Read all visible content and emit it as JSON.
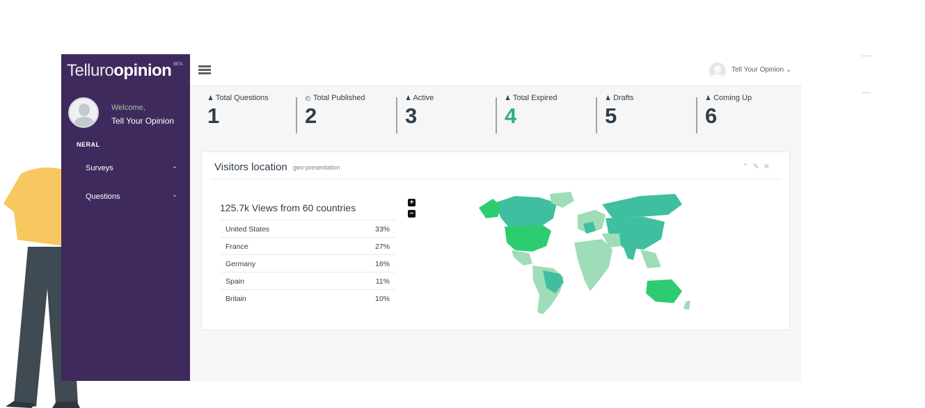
{
  "app": {
    "brand_light": "Telluro",
    "brand_bold": "opinion",
    "brand_beta": "BETA"
  },
  "sidebar": {
    "welcome": "Welcome,",
    "username": "Tell Your Opinion",
    "section_label": "NERAL",
    "items": [
      {
        "label": "Surveys",
        "icon": "clipboard-icon"
      },
      {
        "label": "Questions",
        "icon": "question-icon"
      }
    ]
  },
  "header": {
    "user_menu": "Tell Your Opinion"
  },
  "stats": [
    {
      "caption": "Total Questions",
      "value": "1",
      "icon": "user-icon"
    },
    {
      "caption": "Total Published",
      "value": "2",
      "icon": "clock-icon"
    },
    {
      "caption": "Active",
      "value": "3",
      "icon": "user-icon"
    },
    {
      "caption": "Total Expired",
      "value": "4",
      "icon": "user-icon",
      "color": "#2fb089"
    },
    {
      "caption": "Drafts",
      "value": "5",
      "icon": "user-icon"
    },
    {
      "caption": "Coming Up",
      "value": "6",
      "icon": "user-icon"
    }
  ],
  "panel": {
    "title": "Visitors location",
    "subtitle": "geo-presentation",
    "views_summary": "125.7k Views from 60 countries",
    "countries": [
      {
        "name": "United States",
        "pct": "33%"
      },
      {
        "name": "France",
        "pct": "27%"
      },
      {
        "name": "Germany",
        "pct": "16%"
      },
      {
        "name": "Spain",
        "pct": "11%"
      },
      {
        "name": "Britain",
        "pct": "10%"
      }
    ],
    "zoom_in": "+",
    "zoom_out": "−"
  },
  "colors": {
    "sidebar_bg": "#3e2a5c",
    "accent_green": "#2fb089",
    "map_strong": "#2ecc71",
    "map_mid": "#3fbf9f",
    "map_light": "#9fdcb8"
  }
}
